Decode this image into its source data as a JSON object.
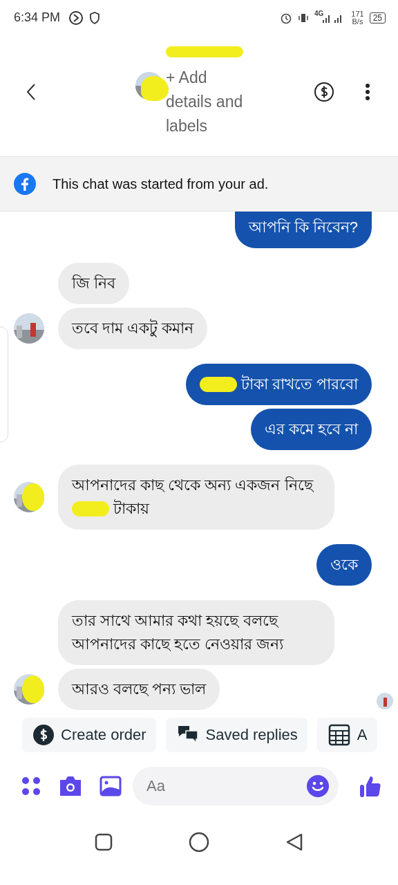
{
  "status_bar": {
    "time": "6:34 PM",
    "network": "4G",
    "speed": "171",
    "speed_unit": "B/s",
    "battery": "25"
  },
  "header": {
    "title_redacted": true,
    "subtitle": "+ Add details and labels",
    "avatar_covered": true
  },
  "ad_banner": {
    "text": "This chat was started from your ad."
  },
  "messages": [
    {
      "kind": "outgoing",
      "segments": [
        {
          "kind": "text",
          "text": "আপনি কি নিবেন?"
        }
      ]
    },
    {
      "kind": "incoming",
      "avatar": false,
      "segments": [
        {
          "kind": "text",
          "text": "জি নিব"
        }
      ]
    },
    {
      "kind": "incoming",
      "avatar": true,
      "avatar_covered": false,
      "segments": [
        {
          "kind": "text",
          "text": "তবে দাম একটু কমান"
        }
      ]
    },
    {
      "kind": "outgoing",
      "segments": [
        {
          "kind": "redaction"
        },
        {
          "kind": "text",
          "text": "টাকা রাখতে পারবো"
        }
      ]
    },
    {
      "kind": "outgoing",
      "segments": [
        {
          "kind": "text",
          "text": "এর কমে হবে না"
        }
      ]
    },
    {
      "kind": "incoming",
      "avatar": true,
      "avatar_covered": true,
      "segments": [
        {
          "kind": "text",
          "text": "আপনাদের কাছ থেকে অন্য একজন নিছে"
        },
        {
          "kind": "redaction"
        },
        {
          "kind": "text",
          "text": "টাকায়"
        }
      ]
    },
    {
      "kind": "outgoing",
      "segments": [
        {
          "kind": "text",
          "text": "ওকে"
        }
      ]
    },
    {
      "kind": "incoming",
      "avatar": false,
      "segments": [
        {
          "kind": "text",
          "text": "তার সাথে আমার কথা হয়ছে বলছে আপনাদের কাছে হতে নেওয়ার জন্য"
        }
      ]
    },
    {
      "kind": "incoming",
      "avatar": true,
      "avatar_covered": true,
      "segments": [
        {
          "kind": "text",
          "text": "আরও বলছে পন্য ভাল"
        }
      ]
    }
  ],
  "quick_replies": [
    {
      "kind": "order",
      "label": "Create order"
    },
    {
      "kind": "saved",
      "label": "Saved replies"
    },
    {
      "kind": "table",
      "label": "A"
    }
  ],
  "composer": {
    "placeholder": "Aa"
  }
}
